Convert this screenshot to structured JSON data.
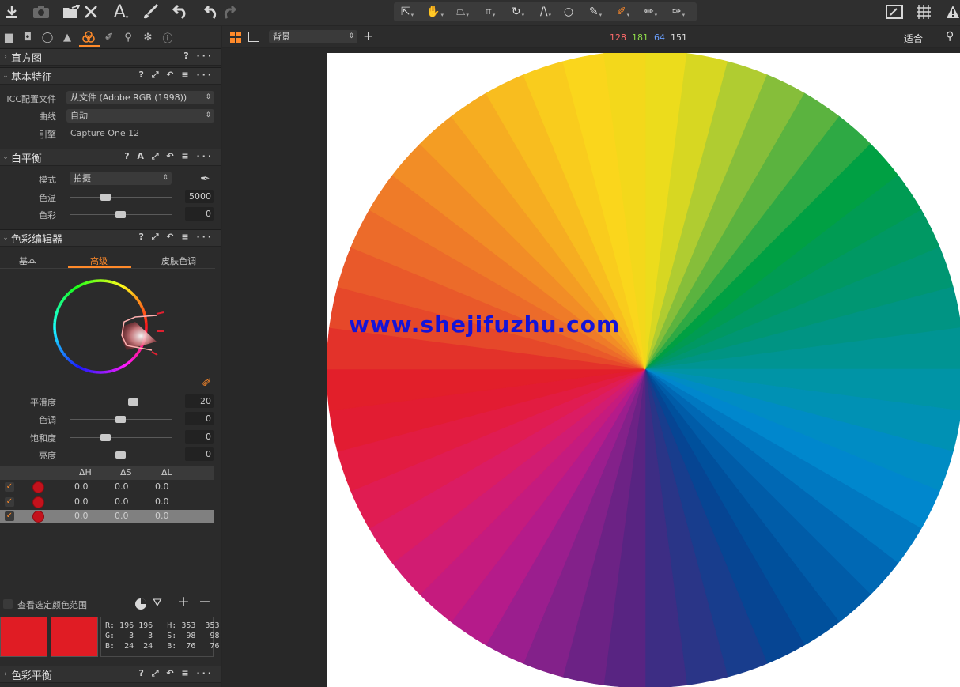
{
  "toolbar": {
    "left_icons": [
      "import-icon",
      "camera-icon",
      "export-icon",
      "delete-icon",
      "text-icon",
      "brush-icon",
      "undo-icon",
      "redo-icon"
    ],
    "tools": [
      "select-cursor-icon",
      "pan-hand-icon",
      "straighten-icon",
      "crop-icon",
      "rotate-icon",
      "keystone-icon",
      "spot-circle-icon",
      "picker-icon",
      "color-picker-icon",
      "brush-mask-icon",
      "eraser-icon"
    ],
    "right_icons": [
      "edit-image-icon",
      "grid-icon",
      "warning-icon"
    ]
  },
  "tool_tabs": [
    "library-icon",
    "capture-icon",
    "lens-icon",
    "exposure-icon",
    "color-icon",
    "details-icon",
    "local-adjustments-icon",
    "adjustments-icon",
    "metadata-icon"
  ],
  "sections": {
    "histogram": {
      "title": "直方图",
      "tools": "? ···"
    },
    "base": {
      "title": "基本特征",
      "tools": "? ⤢ ↶ ≡ ···",
      "icc_label": "ICC配置文件",
      "icc_value": "从文件 (Adobe RGB (1998))",
      "curve_label": "曲线",
      "curve_value": "自动",
      "engine_label": "引擎",
      "engine_value": "Capture One 12"
    },
    "white_balance": {
      "title": "白平衡",
      "tools": "? A ⤢ ↶ ≡ ···",
      "mode_label": "模式",
      "mode_value": "拍摄",
      "temp_label": "色温",
      "temp_value": "5000",
      "temp_position": 0.34,
      "tint_label": "色彩",
      "tint_value": "0",
      "tint_position": 0.5
    },
    "color_editor": {
      "title": "色彩编辑器",
      "tools": "? ⤢ ↶ ≡ ···",
      "tabs": [
        "基本",
        "高级",
        "皮肤色调"
      ],
      "active_tab": "高级",
      "sliders": [
        {
          "label": "平滑度",
          "value": "20",
          "position": 0.64
        },
        {
          "label": "色调",
          "value": "0",
          "position": 0.5
        },
        {
          "label": "饱和度",
          "value": "0",
          "position": 0.34
        },
        {
          "label": "亮度",
          "value": "0",
          "position": 0.5
        }
      ],
      "columns": [
        "ΔH",
        "ΔS",
        "ΔL"
      ],
      "rows": [
        {
          "dh": "0.0",
          "ds": "0.0",
          "dl": "0.0",
          "checked": true,
          "selected": false
        },
        {
          "dh": "0.0",
          "ds": "0.0",
          "dl": "0.0",
          "checked": true,
          "selected": false
        },
        {
          "dh": "0.0",
          "ds": "0.0",
          "dl": "0.0",
          "checked": true,
          "selected": true
        }
      ],
      "view_range_label": "查看选定颜色范围",
      "add_label": "+",
      "remove_label": "−",
      "swatch_color": "#e01c24",
      "readout": {
        "line1": "R: 196 196   H: 353  353",
        "line2": "G:   3   3   S:  98   98",
        "line3": "B:  24  24   B:  76   76"
      }
    },
    "color_balance": {
      "title": "色彩平衡",
      "tools": "? ⤢ ↶ ≡ ···"
    }
  },
  "viewer": {
    "background_label": "背景",
    "rgb": {
      "r": "128",
      "g": "181",
      "b": "64",
      "l": "151"
    },
    "fit_label": "适合",
    "watermark": "www.shejifuzhu.com"
  },
  "colors": {
    "accent": "#ff8a2a",
    "wheel": [
      "#ecdc1c",
      "#d7d722",
      "#b0cc31",
      "#86be3a",
      "#5bb33f",
      "#2ea944",
      "#00a043",
      "#009b53",
      "#009863",
      "#009672",
      "#009483",
      "#009493",
      "#0094a6",
      "#0091b4",
      "#008cc4",
      "#0087cd",
      "#0078c1",
      "#0068b4",
      "#005ca8",
      "#00509c",
      "#064593",
      "#183d8d",
      "#2a3587",
      "#3d2d84",
      "#582482",
      "#6c2285",
      "#83218a",
      "#9b1e8e",
      "#b51b8a",
      "#c51b7e",
      "#d11c72",
      "#db1c63",
      "#e01c52",
      "#e21c41",
      "#e21c32",
      "#e21f2a",
      "#e3322a",
      "#e6482a",
      "#e9592a",
      "#ec6b2a",
      "#ef7b28",
      "#f28d26",
      "#f49d23",
      "#f6ad21",
      "#f8bd1f",
      "#f9cc1d",
      "#fad61c",
      "#f3d81b"
    ]
  }
}
